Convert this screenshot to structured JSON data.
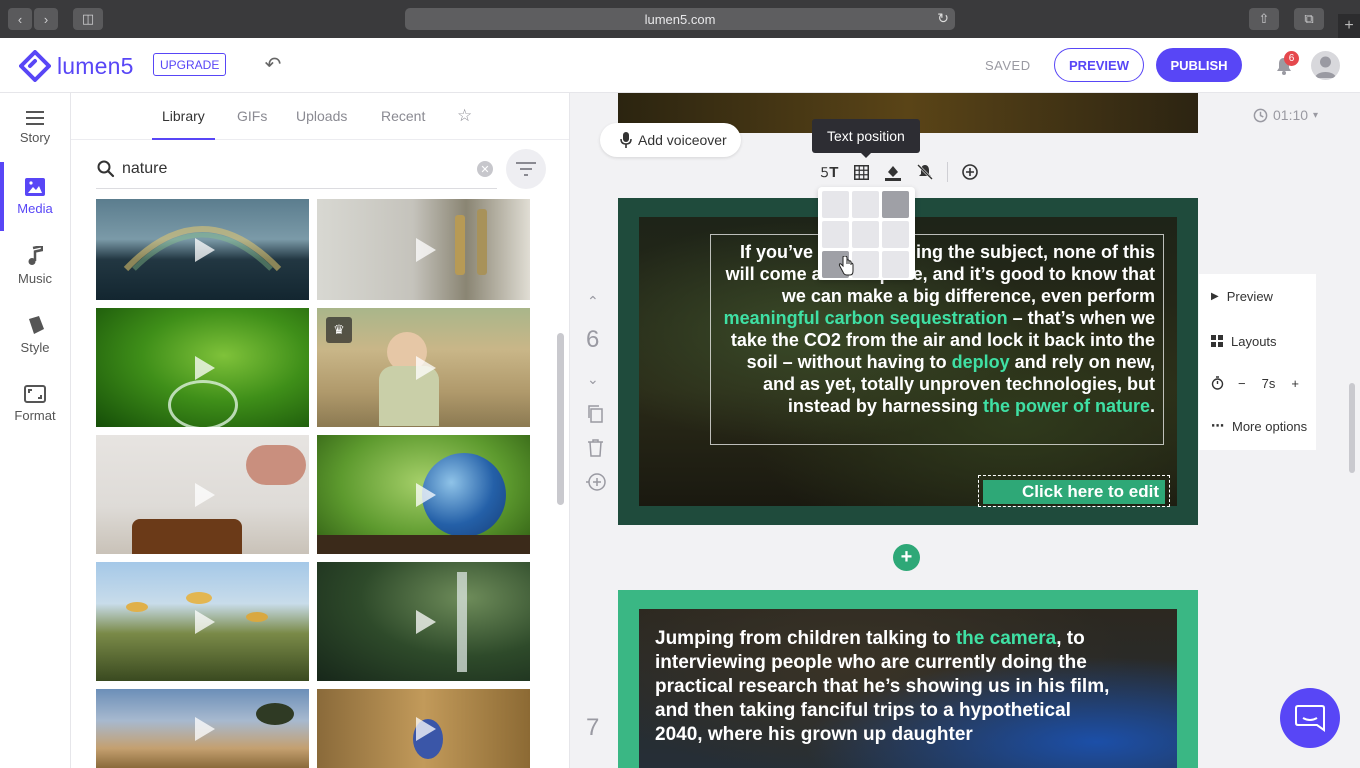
{
  "browser": {
    "url": "lumen5.com"
  },
  "header": {
    "logo_text": "lumen5",
    "upgrade_label": "UPGRADE",
    "saved_label": "SAVED",
    "preview_label": "PREVIEW",
    "publish_label": "PUBLISH",
    "notification_count": "6"
  },
  "nav": {
    "items": [
      {
        "label": "Story",
        "icon": "menu-lines-icon"
      },
      {
        "label": "Media",
        "icon": "image-icon"
      },
      {
        "label": "Music",
        "icon": "music-note-icon"
      },
      {
        "label": "Style",
        "icon": "paint-icon"
      },
      {
        "label": "Format",
        "icon": "frame-icon"
      }
    ],
    "active": "Media"
  },
  "media": {
    "tabs": [
      "Library",
      "GIFs",
      "Uploads",
      "Recent"
    ],
    "active_tab": "Library",
    "search_value": "nature",
    "search_placeholder": "Search"
  },
  "editor": {
    "duration": "01:10",
    "voiceover_label": "Add voiceover",
    "tooltip": "Text position",
    "scene6": {
      "number": "6",
      "text_parts": [
        {
          "t": "If you’ve been watching the subject, none of this will come as a surprise, and it’s good to know that we can make a big difference, even perform ",
          "hl": false
        },
        {
          "t": "meaningful carbon sequestration",
          "hl": true
        },
        {
          "t": " – that’s when we take the CO2 from the air and lock it back into the soil – without having to ",
          "hl": false
        },
        {
          "t": "deploy",
          "hl": true
        },
        {
          "t": " and rely on new, and as yet, totally unproven technologies, but instead by harnessing ",
          "hl": false
        },
        {
          "t": "the power of nature",
          "hl": true
        },
        {
          "t": ".",
          "hl": false
        }
      ],
      "cta": "Click here to edit"
    },
    "scene7": {
      "number": "7",
      "text_parts": [
        {
          "t": "Jumping from children talking to ",
          "hl": false
        },
        {
          "t": "the camera",
          "hl": true
        },
        {
          "t": ", to interviewing people who are currently doing the practical research that he’s showing us in his film, and then taking fanciful trips to a hypothetical 2040, where his grown up daughter",
          "hl": false
        }
      ]
    },
    "side_panel": {
      "preview": "Preview",
      "layouts": "Layouts",
      "duration_value": "7s",
      "more": "More options"
    }
  }
}
